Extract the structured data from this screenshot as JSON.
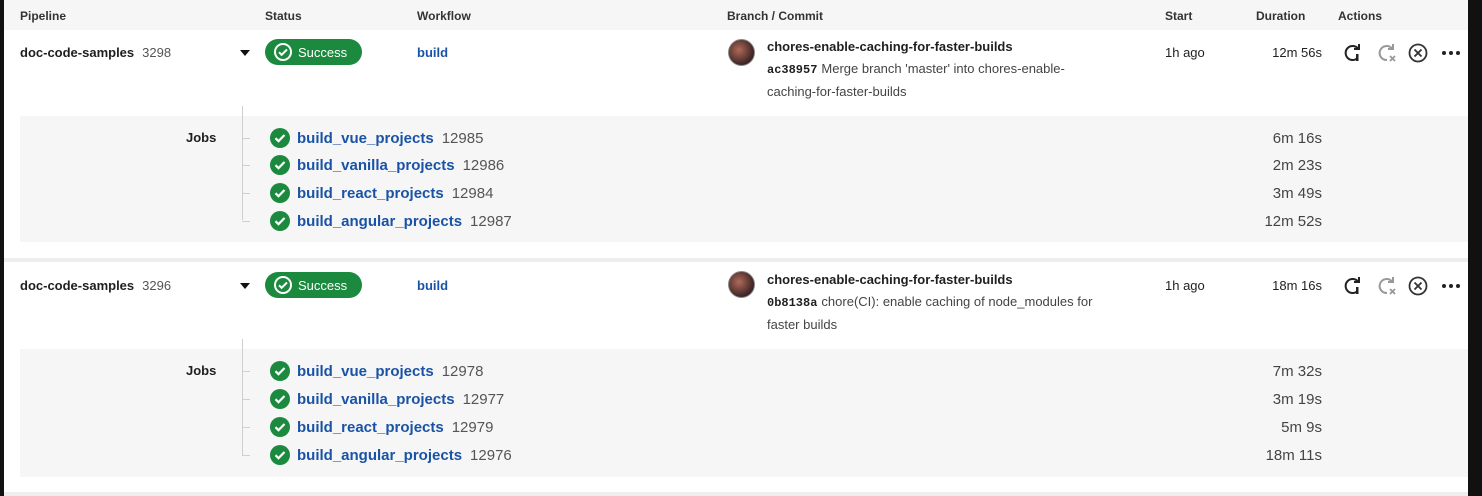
{
  "header": {
    "pipeline": "Pipeline",
    "status": "Status",
    "workflow": "Workflow",
    "branch_commit": "Branch / Commit",
    "start": "Start",
    "duration": "Duration",
    "actions": "Actions"
  },
  "pipelines": [
    {
      "name": "doc-code-samples",
      "id": "3298",
      "status": "Success",
      "workflow": "build",
      "branch": "chores-enable-caching-for-faster-builds",
      "sha": "ac38957",
      "message": "Merge branch 'master' into chores-enable-caching-for-faster-builds",
      "start": "1h ago",
      "duration": "12m 56s",
      "jobs_label": "Jobs",
      "jobs": [
        {
          "name": "build_vue_projects",
          "id": "12985",
          "duration": "6m 16s"
        },
        {
          "name": "build_vanilla_projects",
          "id": "12986",
          "duration": "2m 23s"
        },
        {
          "name": "build_react_projects",
          "id": "12984",
          "duration": "3m 49s"
        },
        {
          "name": "build_angular_projects",
          "id": "12987",
          "duration": "12m 52s"
        }
      ]
    },
    {
      "name": "doc-code-samples",
      "id": "3296",
      "status": "Success",
      "workflow": "build",
      "branch": "chores-enable-caching-for-faster-builds",
      "sha": "0b8138a",
      "message": "chore(CI): enable caching of node_modules for faster builds",
      "start": "1h ago",
      "duration": "18m 16s",
      "jobs_label": "Jobs",
      "jobs": [
        {
          "name": "build_vue_projects",
          "id": "12978",
          "duration": "7m 32s"
        },
        {
          "name": "build_vanilla_projects",
          "id": "12977",
          "duration": "3m 19s"
        },
        {
          "name": "build_react_projects",
          "id": "12979",
          "duration": "5m 9s"
        },
        {
          "name": "build_angular_projects",
          "id": "12976",
          "duration": "18m 11s"
        }
      ]
    }
  ],
  "icons": {
    "rerun": "rerun-icon",
    "rerun_failed": "rerun-failed-icon",
    "cancel": "cancel-icon",
    "more": "more-icon",
    "success": "check-circle-icon"
  },
  "colors": {
    "success": "#1b8a3e",
    "link": "#1a53a6"
  }
}
